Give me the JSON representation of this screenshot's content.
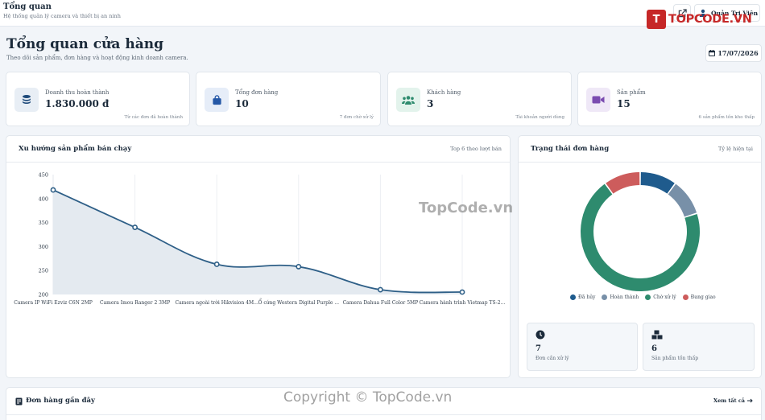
{
  "header": {
    "title": "Tổng quan",
    "subtitle": "Hệ thống quản lý camera và thiết bị an ninh",
    "user_name": "Quản Trị Viên"
  },
  "logo": {
    "mark": "T",
    "text": "TOPCODE.VN"
  },
  "page": {
    "title": "Tổng quan cửa hàng",
    "subtitle": "Theo dõi sản phẩm, đơn hàng và hoạt động kinh doanh camera.",
    "date": "17/07/2026"
  },
  "stats": [
    {
      "label": "Doanh thu hoàn thành",
      "value": "1.830.000 đ",
      "note": "Từ các đơn đã hoàn thành",
      "icon": "coins-icon",
      "color": "#1e4a7a",
      "bg": "#e8eef5"
    },
    {
      "label": "Tổng đơn hàng",
      "value": "10",
      "note": "7 đơn chờ xử lý",
      "icon": "shopping-bag-icon",
      "color": "#2457a6",
      "bg": "#e6edf8"
    },
    {
      "label": "Khách hàng",
      "value": "3",
      "note": "Tài khoản người dùng",
      "icon": "users-icon",
      "color": "#2e8b6e",
      "bg": "#e3f3ec"
    },
    {
      "label": "Sản phẩm",
      "value": "15",
      "note": "6 sản phẩm tồn kho thấp",
      "icon": "video-camera-icon",
      "color": "#7a4bb0",
      "bg": "#efe8f7"
    }
  ],
  "trend": {
    "title": "Xu hướng sản phẩm bán chạy",
    "right": "Top 6 theo lượt bán"
  },
  "status": {
    "title": "Trạng thái đơn hàng",
    "right": "Tỷ lệ hiện tại",
    "mini": [
      {
        "value": "7",
        "label": "Đơn cần xử lý",
        "icon": "clock-icon"
      },
      {
        "value": "6",
        "label": "Sản phẩm tồn thấp",
        "icon": "boxes-icon"
      }
    ]
  },
  "recent": {
    "title": "Đơn hàng gần đây",
    "link": "Xem tất cả"
  },
  "watermarks": {
    "center": "TopCode.vn",
    "bottom": "Copyright © TopCode.vn"
  },
  "chart_data": [
    {
      "type": "area",
      "title": "Xu hướng sản phẩm bán chạy",
      "categories": [
        "Camera IP WiFi Ezviz C6N 2MP",
        "Camera Imou Ranger 2 3MP",
        "Camera ngoài trời Hikvision 4M...",
        "Ổ cứng Western Digital Purple ...",
        "Camera Dahua Full Color 5MP",
        "Camera hành trình Vietmap TS-2..."
      ],
      "values": [
        418,
        340,
        263,
        258,
        210,
        205
      ],
      "ylim": [
        200,
        450
      ],
      "yticks": [
        200,
        250,
        300,
        350,
        400,
        450
      ],
      "line_color": "#2e5f87",
      "fill_color": "#e4eaf0",
      "grid": "vertical"
    },
    {
      "type": "pie",
      "title": "Trạng thái đơn hàng",
      "labels": [
        "Đã hủy",
        "Hoàn thành",
        "Chờ xử lý",
        "Đang giao"
      ],
      "values": [
        1,
        1,
        7,
        1
      ],
      "colors": [
        "#1f5b8d",
        "#7890a8",
        "#2e8b6e",
        "#cd5c5c"
      ],
      "legend": "bottom"
    }
  ]
}
